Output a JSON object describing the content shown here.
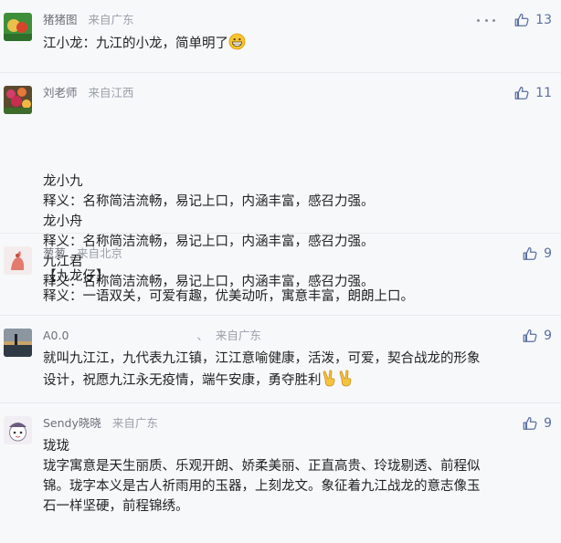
{
  "comments": [
    {
      "name": "猪猪图",
      "location": "来自广东",
      "likes": "13",
      "lines": [
        "江小龙：九江的小龙，简单明了"
      ]
    },
    {
      "name": "刘老师",
      "location": "来自江西",
      "likes": "11",
      "lines": [
        "龙小九",
        "释义：名称简洁流畅，易记上口，内涵丰富，感召力强。",
        "龙小舟",
        "释义：名称简洁流畅，易记上口，内涵丰富，感召力强。",
        "九江君",
        "释义：名称简洁流畅，易记上口，内涵丰富，感召力强。"
      ]
    },
    {
      "name": "葱葱",
      "location": "来自北京",
      "likes": "9",
      "lines": [
        "【九龙仔】",
        "释义：一语双关，可爱有趣，优美动听，寓意丰富，朗朗上口。"
      ]
    },
    {
      "name": "A0.0",
      "mark": "、",
      "location": "来自广东",
      "likes": "9",
      "lines": [
        "就叫九江江，九代表九江镇，江江意喻健康，活泼，可爱，契合战龙的形象",
        "设计，祝愿九江永无疫情，端午安康，勇夺胜利"
      ]
    },
    {
      "name": "Sendy晓晓",
      "location": "来自广东",
      "likes": "9",
      "lines": [
        "珑珑",
        "珑字寓意是天生丽质、乐观开朗、娇柔美丽、正直高贵、玲珑剔透、前程似",
        "锦。珑字本义是古人祈雨用的玉器，上刻龙文。象征着九江战龙的意志像玉",
        "石一样坚硬，前程锦绣。"
      ]
    }
  ]
}
